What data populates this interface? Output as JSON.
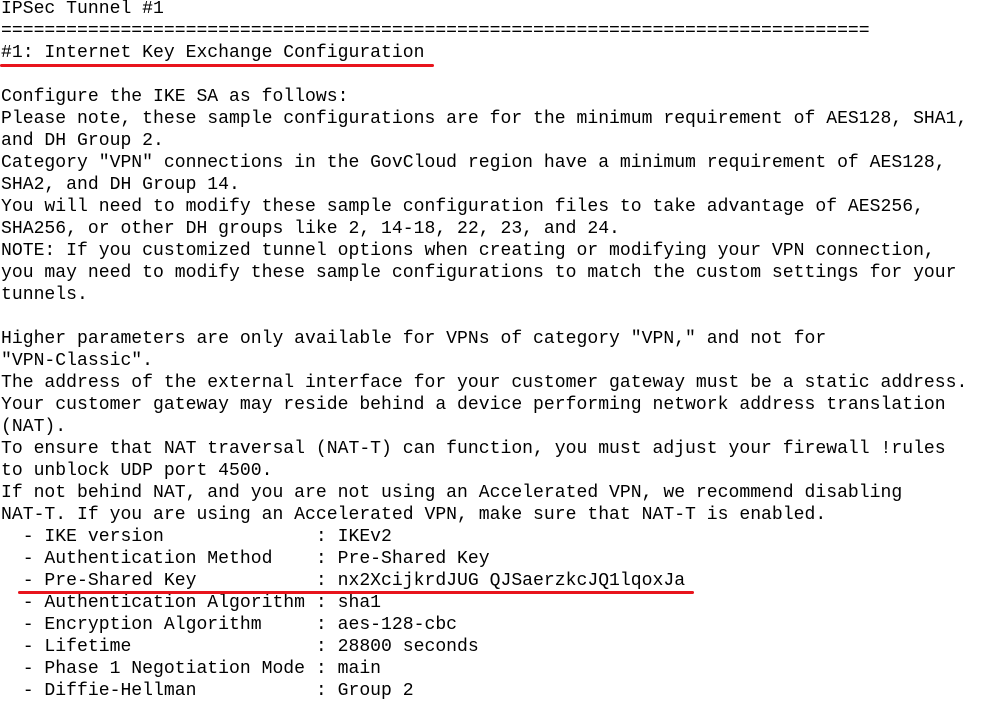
{
  "document": {
    "lines": [
      "IPSec Tunnel #1",
      "================================================================================",
      "#1: Internet Key Exchange Configuration",
      "",
      "Configure the IKE SA as follows:",
      "Please note, these sample configurations are for the minimum requirement of AES128, SHA1,",
      "and DH Group 2.",
      "Category \"VPN\" connections in the GovCloud region have a minimum requirement of AES128,",
      "SHA2, and DH Group 14.",
      "You will need to modify these sample configuration files to take advantage of AES256,",
      "SHA256, or other DH groups like 2, 14-18, 22, 23, and 24.",
      "NOTE: If you customized tunnel options when creating or modifying your VPN connection,",
      "you may need to modify these sample configurations to match the custom settings for your",
      "tunnels.",
      "",
      "Higher parameters are only available for VPNs of category \"VPN,\" and not for",
      "\"VPN-Classic\".",
      "The address of the external interface for your customer gateway must be a static address.",
      "Your customer gateway may reside behind a device performing network address translation",
      "(NAT).",
      "To ensure that NAT traversal (NAT-T) can function, you must adjust your firewall !rules",
      "to unblock UDP port 4500.",
      "If not behind NAT, and you are not using an Accelerated VPN, we recommend disabling",
      "NAT-T. If you are using an Accelerated VPN, make sure that NAT-T is enabled.",
      "  - IKE version              : IKEv2",
      "  - Authentication Method    : Pre-Shared Key",
      "  - Pre-Shared Key           : nx2XcijkrdJUG QJSaerzkcJQ1lqoxJa",
      "  - Authentication Algorithm : sha1",
      "  - Encryption Algorithm     : aes-128-cbc",
      "  - Lifetime                 : 28800 seconds",
      "  - Phase 1 Negotiation Mode : main",
      "  - Diffie-Hellman           : Group 2"
    ]
  },
  "annotations": {
    "underline_color": "#e8141c"
  }
}
